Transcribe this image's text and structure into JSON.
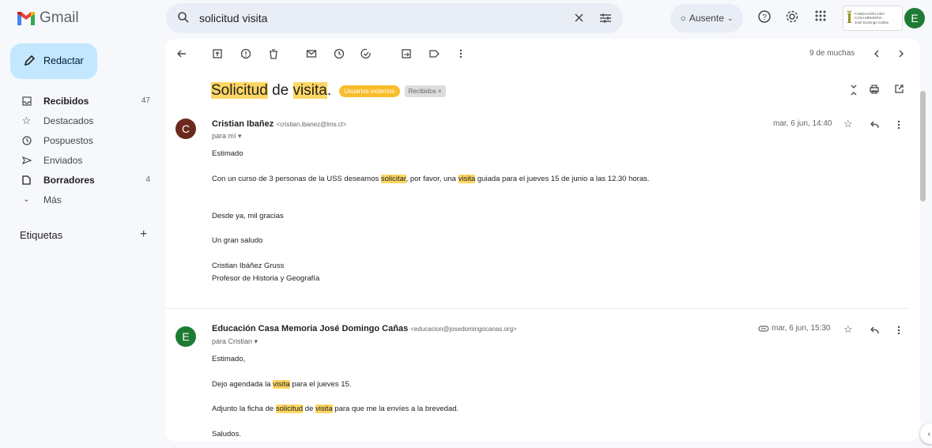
{
  "app": {
    "name": "Gmail"
  },
  "search": {
    "query": "solicitud visita"
  },
  "status": {
    "label": "Ausente"
  },
  "account": {
    "initial": "E",
    "org_lines": [
      "FUNDACIÓN 1367",
      "CASA MEMORIA",
      "José Domingo Cañas"
    ]
  },
  "sidebar": {
    "compose_label": "Redactar",
    "items": [
      {
        "label": "Recibidos",
        "count": "47",
        "bold": true
      },
      {
        "label": "Destacados",
        "count": ""
      },
      {
        "label": "Pospuestos",
        "count": ""
      },
      {
        "label": "Enviados",
        "count": ""
      },
      {
        "label": "Borradores",
        "count": "4",
        "bold": true
      },
      {
        "label": "Más",
        "count": ""
      }
    ],
    "labels_heading": "Etiquetas"
  },
  "toolbar": {
    "pager": "9 de muchas"
  },
  "thread": {
    "subject_parts": [
      "Solicitud",
      " de ",
      "visita",
      "."
    ],
    "chip_external": "Usuarios externos",
    "chip_inbox": "Recibidos ×"
  },
  "messages": [
    {
      "initial": "C",
      "color": "#6b2a1d",
      "sender": "Cristian Ibañez",
      "email": "<cristian.ibanez@lms.cl>",
      "to": "para mí ▾",
      "date": "mar, 6 jun, 14:40",
      "greeting": "Estimado",
      "line1_a": "Con un curso de 3 personas de la USS  deseamos ",
      "line1_b": "solicitar",
      "line1_c": ", por favor, una ",
      "line1_d": "visita",
      "line1_e": " guiada para el jueves 15 de junio a las 12.30 horas.",
      "thanks": "Desde ya, mil gracias",
      "bye": "Un gran saludo",
      "sig1": "Cristian Ibáñez Gruss",
      "sig2": "Profesor de Historia y Geografía"
    },
    {
      "initial": "E",
      "color": "#1e7b34",
      "sender": "Educación Casa Memoria José Domingo Cañas",
      "email": "<educacion@josedomingocanas.org>",
      "to": "para Cristian ▾",
      "date": "mar, 6 jun, 15:30",
      "greeting": "Estimado,",
      "l1a": "Dejo agendada la ",
      "l1b": "visita",
      "l1c": " para el jueves 15.",
      "l2a": "Adjunto la ficha de ",
      "l2b": "solicitud",
      "l2c": " de ",
      "l2d": "visita",
      "l2e": " para que me la envíes a la brevedad.",
      "bye": "Saludos."
    }
  ]
}
